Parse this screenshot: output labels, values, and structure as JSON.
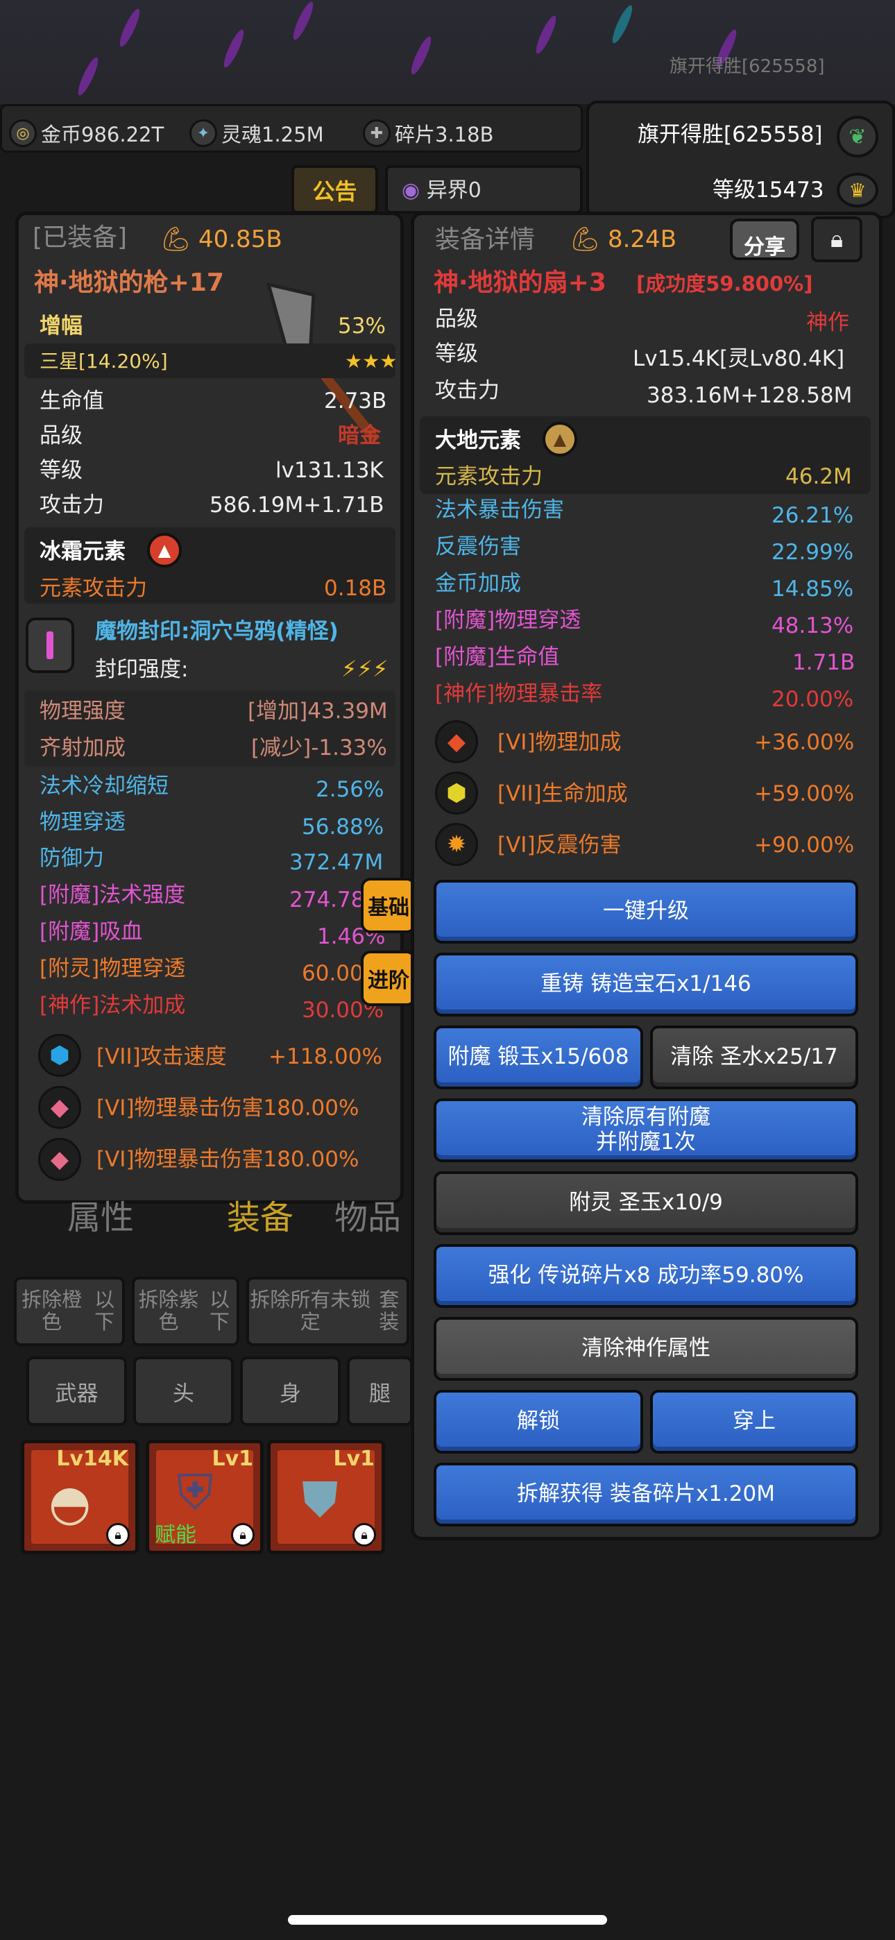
{
  "watermark": "旗开得胜[625558]",
  "currency": {
    "gold": "金币986.22T",
    "soul": "灵魂1.25M",
    "shard": "碎片3.18B"
  },
  "player": {
    "name": "旗开得胜[625558]",
    "level": "等级15473"
  },
  "notice": "公告",
  "otherworld": "异界0",
  "equipped": {
    "header": "[已装备]",
    "power": "40.85B",
    "item_name": "神·地狱的枪+17",
    "boost_label": "增幅",
    "boost_value": "53%",
    "star_label": "三星[14.20%]",
    "stars": "★★★",
    "hp_label": "生命值",
    "hp_value": "2.73B",
    "grade_label": "品级",
    "grade_value": "暗金",
    "level_label": "等级",
    "level_value": "lv131.13K",
    "atk_label": "攻击力",
    "atk_value": "586.19M+1.71B",
    "element_title": "冰霜元素",
    "element_atk_label": "元素攻击力",
    "element_atk_value": "0.18B",
    "seal_name": "魔物封印:洞穴乌鸦(精怪)",
    "seal_strength_label": "封印强度:",
    "seal_stats": [
      {
        "label": "物理强度",
        "value": "[增加]43.39M"
      },
      {
        "label": "齐射加成",
        "value": "[减少]-1.33%"
      }
    ],
    "stats": [
      {
        "label": "法术冷却缩短",
        "value": "2.56%",
        "color": "#4fb6e8"
      },
      {
        "label": "物理穿透",
        "value": "56.88%",
        "color": "#4fb6e8"
      },
      {
        "label": "防御力",
        "value": "372.47M",
        "color": "#4fb6e8"
      },
      {
        "label": "[附魔]法术强度",
        "value": "274.78",
        "color": "#e255d0"
      },
      {
        "label": "[附魔]吸血",
        "value": "1.46%",
        "color": "#e255d0"
      },
      {
        "label": "[附灵]物理穿透",
        "value": "60.00",
        "color": "#ee7a2a"
      },
      {
        "label": "[神作]法术加成",
        "value": "30.00%",
        "color": "#e23a3a"
      }
    ],
    "gems": [
      {
        "label": "[VII]攻击速度",
        "value": "+118.00%",
        "icon": "blue-crystal-icon"
      },
      {
        "label": "[VI]物理暴击伤害180.00%",
        "value": "",
        "icon": "pink-diamond-icon"
      },
      {
        "label": "[VI]物理暴击伤害180.00%",
        "value": "",
        "icon": "pink-diamond-icon"
      }
    ],
    "side_tabs": [
      "基础",
      "进阶"
    ]
  },
  "detail": {
    "header": "装备详情",
    "power": "8.24B",
    "share": "分享",
    "item_name": "神·地狱的扇+3",
    "success_rate": "[成功度59.800%]",
    "grade_label": "品级",
    "grade_value": "神作",
    "level_label": "等级",
    "level_value": "Lv15.4K[灵Lv80.4K]",
    "atk_label": "攻击力",
    "atk_value": "383.16M+128.58M",
    "element_title": "大地元素",
    "element_atk_label": "元素攻击力",
    "element_atk_value": "46.2M",
    "stats": [
      {
        "label": "法术暴击伤害",
        "value": "26.21%",
        "color": "#4fb6e8"
      },
      {
        "label": "反震伤害",
        "value": "22.99%",
        "color": "#4fb6e8"
      },
      {
        "label": "金币加成",
        "value": "14.85%",
        "color": "#4fb6e8"
      },
      {
        "label": "[附魔]物理穿透",
        "value": "48.13%",
        "color": "#e255d0"
      },
      {
        "label": "[附魔]生命值",
        "value": "1.71B",
        "color": "#e255d0"
      },
      {
        "label": "[神作]物理暴击率",
        "value": "20.00%",
        "color": "#e23a3a"
      }
    ],
    "gems": [
      {
        "label": "[VI]物理加成",
        "value": "+36.00%",
        "icon": "red-diamond-icon"
      },
      {
        "label": "[VII]生命加成",
        "value": "+59.00%",
        "icon": "yellow-crystal-icon"
      },
      {
        "label": "[VI]反震伤害",
        "value": "+90.00%",
        "icon": "orange-sun-icon"
      }
    ],
    "buttons": {
      "upgrade": "一键升级",
      "recast": "重铸 铸造宝石x1/146",
      "enchant": "附魔 锻玉x15/608",
      "clear": "清除 圣水x25/17",
      "clear_enchant_1": "清除原有附魔",
      "clear_enchant_2": "并附魔1次",
      "spirit": "附灵 圣玉x10/9",
      "strengthen": "强化 传说碎片x8 成功率59.80%",
      "clear_god": "清除神作属性",
      "unlock": "解锁",
      "wear": "穿上",
      "dismantle": "拆解获得 装备碎片x1.20M"
    }
  },
  "bottom": {
    "tabs": [
      "属性",
      "装备",
      "物品"
    ],
    "filters": [
      [
        "拆除橙色",
        "以下"
      ],
      [
        "拆除紫色",
        "以下"
      ],
      [
        "拆除所有未锁定",
        "套装"
      ]
    ],
    "slots": [
      "武器",
      "头",
      "身",
      "腿"
    ],
    "cards": [
      {
        "level": "Lv14K",
        "label": ""
      },
      {
        "level": "Lv1",
        "label": "赋能"
      },
      {
        "level": "Lv1",
        "label": ""
      }
    ]
  }
}
